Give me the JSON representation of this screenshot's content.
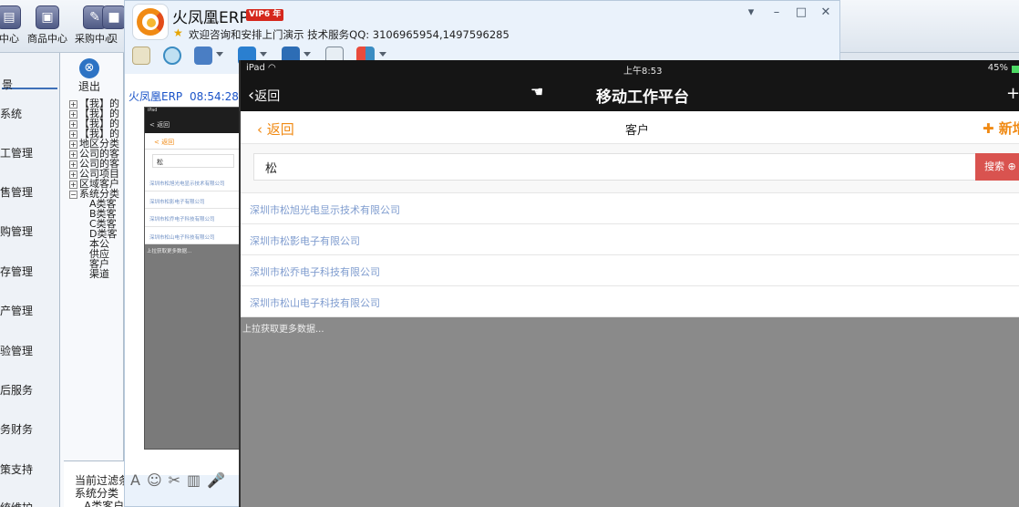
{
  "erp": {
    "top_modules": [
      {
        "label": "中心",
        "icon": "app-icon"
      },
      {
        "label": "商品中心",
        "icon": "product-icon"
      },
      {
        "label": "采购中心",
        "icon": "purchase-icon"
      },
      {
        "label": "贝",
        "icon": "module-icon"
      }
    ],
    "left_header": "景",
    "left_items": [
      "系统",
      "工管理",
      "售管理",
      "购管理",
      "存管理",
      "产管理",
      "验管理",
      "后服务",
      "务财务",
      "策支持",
      "统维护"
    ],
    "exit_label": "退出",
    "tree_nodes": [
      "【我】的",
      "【我】的",
      "【我】的",
      "【我】的",
      "地区分类",
      "公司的客",
      "公司的客",
      "公司项目",
      "区域客户",
      "系统分类"
    ],
    "tree_leaves": [
      "A类客",
      "B类客",
      "C类客",
      "D类客",
      "本公",
      "供应",
      "客户",
      "渠道"
    ],
    "filter_lines": [
      "当前过滤条",
      "系统分类",
      "A类客户"
    ]
  },
  "chat": {
    "title": "火凤凰ERP",
    "vip": "VIP6 年",
    "subtitle": "欢迎咨询和安排上门演示 技术服务QQ:  3106965954,1497596285",
    "sender": "火凤凰ERP",
    "time": "08:54:28",
    "thumb": {
      "status": "iPad",
      "nav": "< 返回",
      "sub": "< 返回",
      "search": "松",
      "rows": [
        "深圳市松旭光电显示技术有限公司",
        "深圳市松影电子有限公司",
        "深圳市松乔电子科技有限公司",
        "深圳市松山电子科技有限公司"
      ],
      "more": "上拉获取更多数据..."
    },
    "input_icons": [
      "A",
      "☺",
      "✂",
      "▥",
      "🎤"
    ]
  },
  "ipad": {
    "status_left": "iPad ",
    "time": "上午8:53",
    "battery": "45%",
    "nav_back": "返回",
    "nav_title": "移动工作平台",
    "sub_back": "返回",
    "sub_title": "客户",
    "add_label": "新增",
    "search_value": "松",
    "search_button": "搜索",
    "customers": [
      "深圳市松旭光电显示技术有限公司",
      "深圳市松影电子有限公司",
      "深圳市松乔电子科技有限公司",
      "深圳市松山电子科技有限公司"
    ],
    "load_more": "上拉获取更多数据..."
  },
  "colors": {
    "accent": "#f08a14",
    "search_button": "#d9534f",
    "link": "#7f9ccf"
  }
}
